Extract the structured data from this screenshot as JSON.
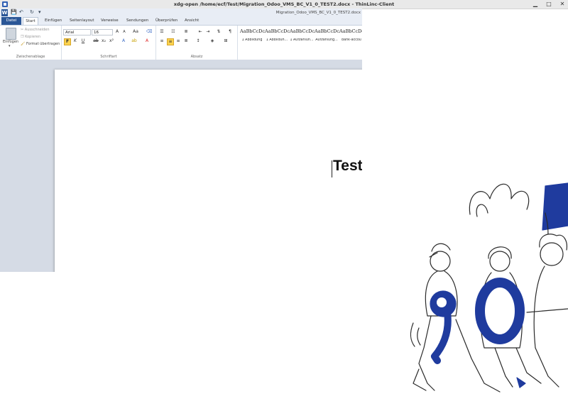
{
  "window": {
    "title": "xdg-open /home/ecf/Test/Migration_Odoo_VMS_BC_V1_0_TEST2.docx - ThinLinc-Client",
    "minimize": "▁",
    "restore": "□",
    "close": "✕"
  },
  "word": {
    "logo": "W",
    "document_title": "Migration_Odoo_VMS_BC_V1_0_TEST2.docx",
    "tabs": [
      "Datei",
      "Start",
      "Einfügen",
      "Seitenlayout",
      "Verweise",
      "Sendungen",
      "Überprüfen",
      "Ansicht"
    ],
    "clipboard": {
      "paste": "Einfügen",
      "cut": "Ausschneiden",
      "copy": "Kopieren",
      "format_painter": "Format übertragen",
      "label": "Zwischenablage"
    },
    "font": {
      "family": "Arial",
      "size": "16",
      "label": "Schriftart"
    },
    "paragraph": {
      "label": "Absatz"
    },
    "styles": [
      {
        "sample": "AaBbCcDc",
        "name": "1 Abbildung"
      },
      {
        "sample": "AaBbCcDc",
        "name": "1 Abbildun..."
      },
      {
        "sample": "AaBbCcDc",
        "name": "1 Aufzählun..."
      },
      {
        "sample": "AaBbCcDc",
        "name": "Aufzählung..."
      },
      {
        "sample": "AaBbCcDc",
        "name": "bank-accou"
      }
    ],
    "document_text": "Test"
  },
  "colors": {
    "file_tab": "#2b5797",
    "illustration_blue": "#1f3b9e"
  }
}
